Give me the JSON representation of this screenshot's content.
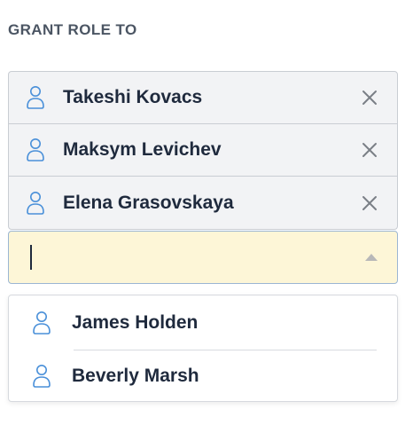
{
  "field": {
    "label": "GRANT ROLE TO"
  },
  "selected_users": [
    {
      "name": "Takeshi Kovacs",
      "remove_icon": "close-icon"
    },
    {
      "name": "Maksym Levichev",
      "remove_icon": "close-icon"
    },
    {
      "name": "Elena Grasovskaya",
      "remove_icon": "close-icon"
    }
  ],
  "search": {
    "value": "",
    "toggle_icon": "chevron-up-icon"
  },
  "dropdown_options": [
    {
      "name": "James Holden",
      "icon": "user-icon"
    },
    {
      "name": "Beverly Marsh",
      "icon": "user-icon"
    }
  ],
  "colors": {
    "icon_blue": "#4a90d9",
    "input_bg": "#fdf6d7",
    "chip_bg": "#f2f3f5",
    "text": "#1f2a3d"
  }
}
